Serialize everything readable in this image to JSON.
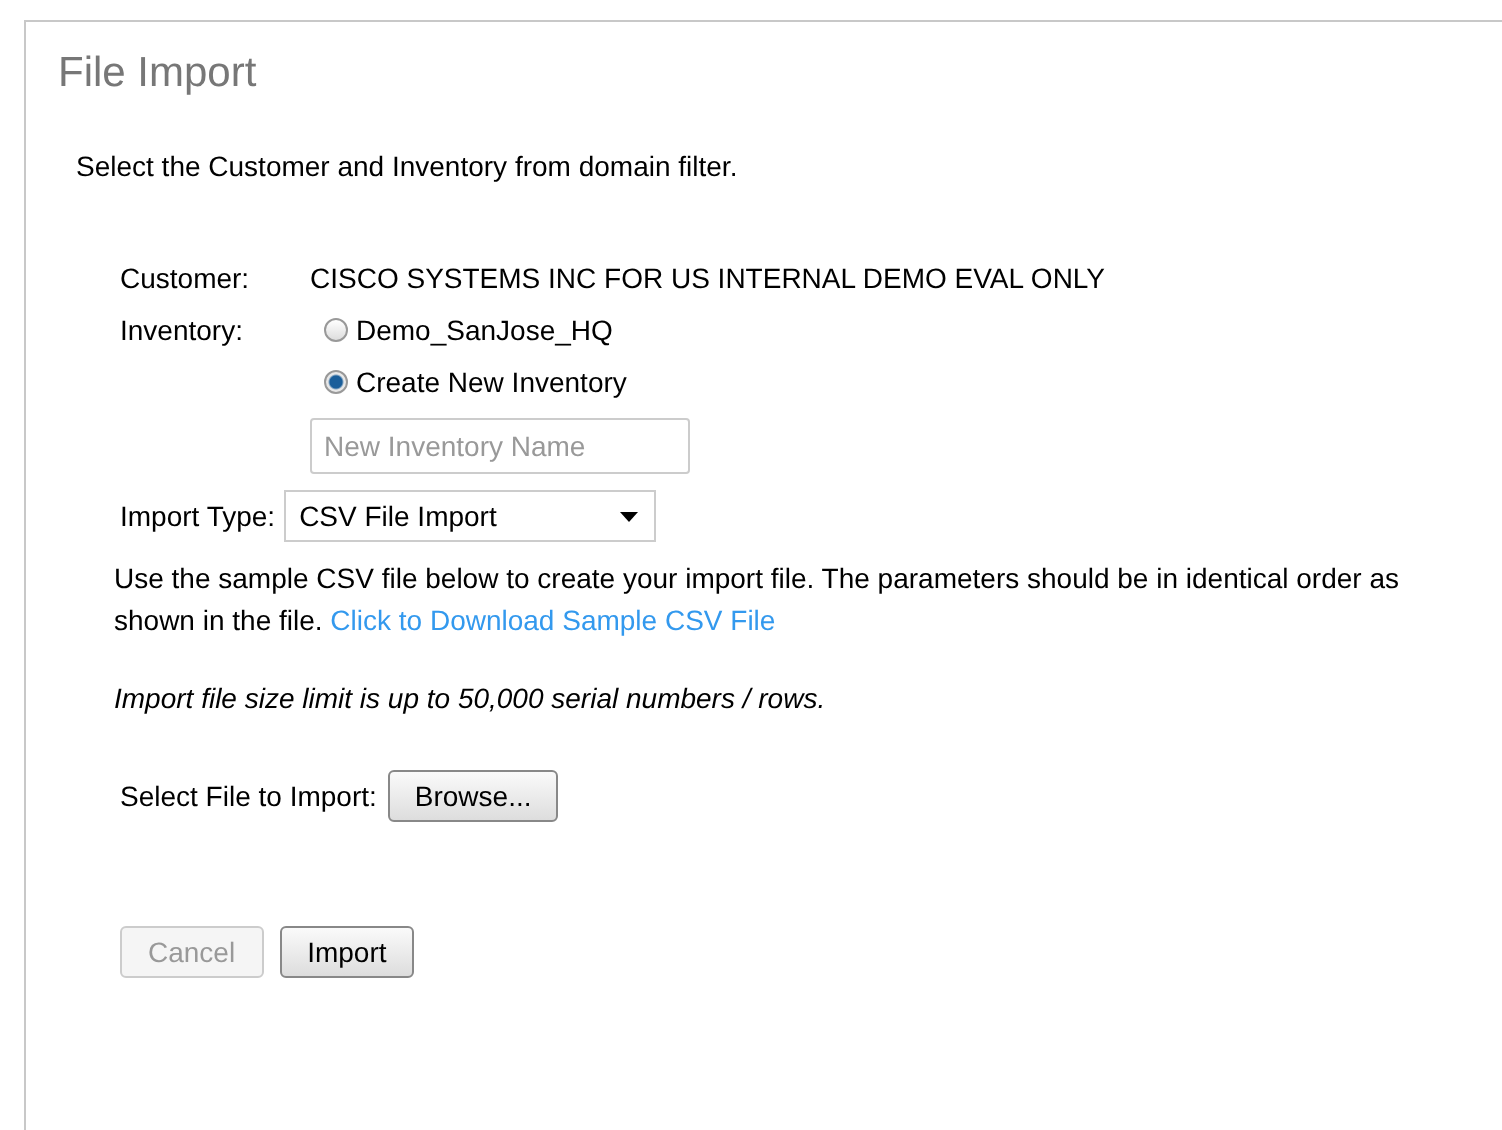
{
  "window": {
    "title": "File Import"
  },
  "intro": "Select the Customer and Inventory from domain filter.",
  "customer": {
    "label": "Customer:",
    "value": "CISCO SYSTEMS INC FOR US INTERNAL DEMO EVAL ONLY"
  },
  "inventory": {
    "label": "Inventory:",
    "options": [
      {
        "label": "Demo_SanJose_HQ",
        "selected": false
      },
      {
        "label": "Create New Inventory",
        "selected": true
      }
    ],
    "name_field": {
      "placeholder": "New Inventory Name"
    }
  },
  "import_type": {
    "label": "Import Type:",
    "value": "CSV File Import"
  },
  "instructions": {
    "text": "Use the sample CSV file below to create your import file. The parameters should be in identical order as shown in the file.",
    "link": "Click to Download Sample CSV File"
  },
  "limit_note": "Import file size limit is up to 50,000 serial numbers / rows.",
  "file": {
    "label": "Select File to Import:",
    "button": "Browse..."
  },
  "buttons": [
    {
      "label": "Cancel",
      "disabled": true
    },
    {
      "label": "Import",
      "disabled": false
    }
  ]
}
